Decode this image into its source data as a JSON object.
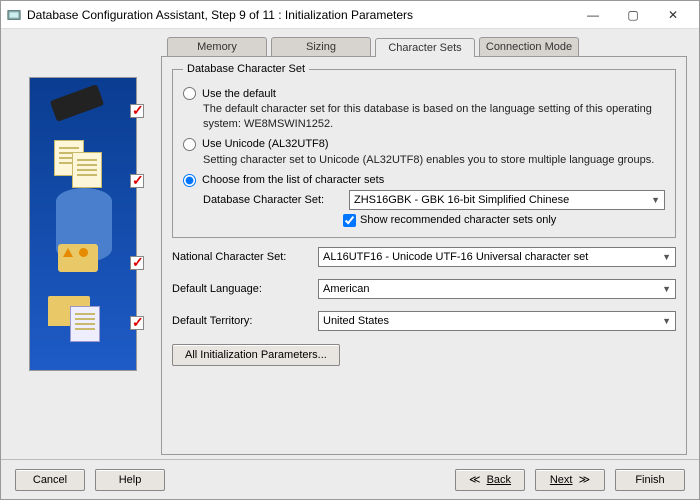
{
  "window": {
    "title": "Database Configuration Assistant, Step 9 of 11 : Initialization Parameters"
  },
  "tabs": {
    "memory": "Memory",
    "sizing": "Sizing",
    "charsets": "Character Sets",
    "connmode": "Connection Mode"
  },
  "group": {
    "legend": "Database Character Set"
  },
  "opt_default": {
    "label": "Use the default",
    "desc": "The default character set for this database is based on the language setting of this operating system: WE8MSWIN1252."
  },
  "opt_unicode": {
    "label": "Use Unicode (AL32UTF8)",
    "desc": "Setting character set to Unicode (AL32UTF8) enables you to store multiple language groups."
  },
  "opt_list": {
    "label": "Choose from the list of character sets",
    "field_label": "Database Character Set:",
    "value": "ZHS16GBK - GBK 16-bit Simplified Chinese",
    "show_recommended": "Show recommended character sets only"
  },
  "natl": {
    "label": "National Character Set:",
    "value": "AL16UTF16 - Unicode UTF-16 Universal character set"
  },
  "lang": {
    "label": "Default Language:",
    "value": "American"
  },
  "terr": {
    "label": "Default Territory:",
    "value": "United States"
  },
  "all_params": "All Initialization Parameters...",
  "footer": {
    "cancel": "Cancel",
    "help": "Help",
    "back": "Back",
    "next": "Next",
    "finish": "Finish"
  }
}
